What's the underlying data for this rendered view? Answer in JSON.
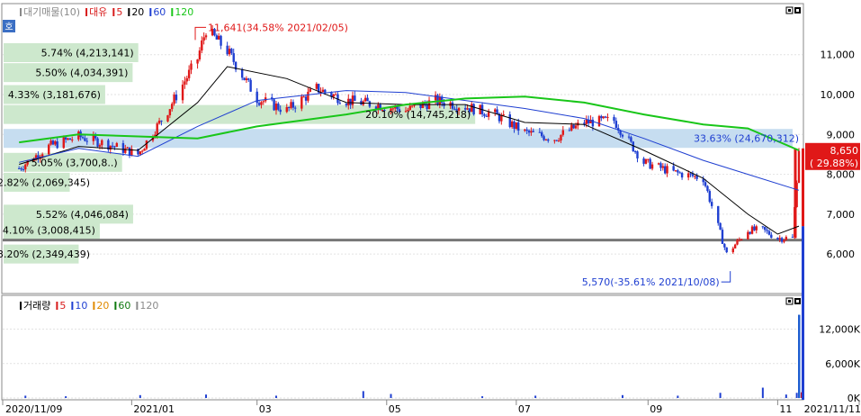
{
  "header": {
    "badge": "호",
    "legend_items": [
      {
        "text": "대기매물(10)",
        "color": "#8a8a8a"
      },
      {
        "text": "대유",
        "color": "#d81b1b"
      },
      {
        "text": "5",
        "color": "#d81b1b"
      },
      {
        "text": "20",
        "color": "#000000"
      },
      {
        "text": "60",
        "color": "#1f3fd1"
      },
      {
        "text": "120",
        "color": "#19c619"
      }
    ]
  },
  "volume_header": {
    "legend_items": [
      {
        "text": "거래량",
        "color": "#000000"
      },
      {
        "text": "5",
        "color": "#d81b1b"
      },
      {
        "text": "10",
        "color": "#1f3fd1"
      },
      {
        "text": "20",
        "color": "#e08a00"
      },
      {
        "text": "60",
        "color": "#0f7a0f"
      },
      {
        "text": "120",
        "color": "#8a8a8a"
      }
    ]
  },
  "chart_data": {
    "type": "candlestick",
    "price_axis": {
      "min": 5000,
      "max": 12000,
      "ticks": [
        "11,000",
        "10,000",
        "9,000",
        "8,000",
        "7,000",
        "6,000"
      ],
      "tick_values": [
        11000,
        10000,
        9000,
        8000,
        7000,
        6000
      ]
    },
    "volume_axis": {
      "min": 0,
      "max": 16000,
      "ticks": [
        "12,000K",
        "6,000K",
        "0K"
      ],
      "tick_values": [
        12000,
        6000,
        0
      ]
    },
    "x_labels": [
      "2020/11/09",
      "2021/01",
      "03",
      "05",
      "07",
      "09",
      "11",
      "2021/11/11"
    ],
    "x_label_dates": [
      "2020-11-09",
      "2021-01-01",
      "2021-03-01",
      "2021-05-01",
      "2021-07-01",
      "2021-09-01",
      "2021-11-01",
      "2021-11-11"
    ],
    "price_series": {
      "dates": [
        "2020-11-09",
        "2020-11-23",
        "2020-12-07",
        "2020-12-21",
        "2021-01-04",
        "2021-01-18",
        "2021-02-01",
        "2021-02-05",
        "2021-02-15",
        "2021-03-01",
        "2021-03-15",
        "2021-03-29",
        "2021-04-12",
        "2021-04-26",
        "2021-05-10",
        "2021-05-24",
        "2021-06-07",
        "2021-06-21",
        "2021-07-05",
        "2021-07-19",
        "2021-08-02",
        "2021-08-16",
        "2021-08-30",
        "2021-09-13",
        "2021-09-27",
        "2021-10-08",
        "2021-10-18",
        "2021-10-25",
        "2021-11-01",
        "2021-11-08",
        "2021-11-11"
      ],
      "close": [
        8150,
        8700,
        8950,
        8750,
        8500,
        9600,
        10900,
        11641,
        11100,
        9900,
        9600,
        10150,
        9850,
        9750,
        9600,
        9850,
        9700,
        9500,
        9050,
        8900,
        9300,
        9350,
        8300,
        8050,
        7900,
        6000,
        6600,
        6600,
        6400,
        6400,
        8650
      ]
    },
    "ma_lines": [
      {
        "name": "20",
        "color": "#000000",
        "dates": [
          "2020-11-09",
          "2020-12-07",
          "2021-01-04",
          "2021-02-01",
          "2021-02-15",
          "2021-03-15",
          "2021-04-12",
          "2021-05-10",
          "2021-06-07",
          "2021-07-05",
          "2021-08-02",
          "2021-08-30",
          "2021-09-27",
          "2021-10-18",
          "2021-11-01",
          "2021-11-11"
        ],
        "values": [
          8250,
          8700,
          8600,
          9800,
          10700,
          10400,
          9800,
          9750,
          9750,
          9300,
          9250,
          8600,
          7900,
          7000,
          6500,
          6700
        ]
      },
      {
        "name": "60",
        "color": "#1f3fd1",
        "dates": [
          "2020-11-09",
          "2020-12-07",
          "2021-01-04",
          "2021-02-01",
          "2021-03-01",
          "2021-04-12",
          "2021-05-10",
          "2021-06-07",
          "2021-07-05",
          "2021-08-02",
          "2021-08-30",
          "2021-09-27",
          "2021-10-18",
          "2021-11-11"
        ],
        "values": [
          8300,
          8650,
          8450,
          9200,
          9850,
          10100,
          10050,
          9850,
          9650,
          9400,
          8900,
          8350,
          8000,
          7600
        ]
      },
      {
        "name": "120",
        "color": "#19c619",
        "dates": [
          "2020-11-09",
          "2020-12-07",
          "2021-01-04",
          "2021-02-01",
          "2021-03-01",
          "2021-04-12",
          "2021-05-10",
          "2021-06-07",
          "2021-07-05",
          "2021-08-02",
          "2021-08-30",
          "2021-09-27",
          "2021-10-18",
          "2021-11-11"
        ],
        "values": [
          8800,
          9000,
          8950,
          8900,
          9200,
          9500,
          9750,
          9900,
          9950,
          9800,
          9500,
          9250,
          9150,
          8600
        ]
      }
    ],
    "volume_profile": [
      {
        "label": "5.74% (4,213,141)",
        "price": 11050,
        "pct": 5.74
      },
      {
        "label": "5.50% (4,034,391)",
        "price": 10550,
        "pct": 5.5
      },
      {
        "label": "4.33% (3,181,676)",
        "price": 10000,
        "pct": 4.33
      },
      {
        "label": "20.10% (14,745,218)",
        "price": 9500,
        "pct": 20.1
      },
      {
        "label": "33.63% (24,670,312)",
        "price": 8900,
        "pct": 33.63
      },
      {
        "label": "5.05% (3,700,8..)",
        "price": 8300,
        "pct": 5.05
      },
      {
        "label": "2.82% (2,069,345)",
        "price": 7800,
        "pct": 2.82
      },
      {
        "label": "5.52% (4,046,084)",
        "price": 7000,
        "pct": 5.52
      },
      {
        "label": "4.10% (3,008,415)",
        "price": 6600,
        "pct": 4.1
      },
      {
        "label": "3.20% (2,349,439)",
        "price": 6000,
        "pct": 3.2
      }
    ],
    "reference_line": {
      "price": 6350
    },
    "annotations": {
      "high": {
        "text": "11,641(34.58% 2021/02/05)",
        "date": "2021-02-05",
        "price": 11641
      },
      "low": {
        "text": "5,570(-35.61% 2021/10/08)",
        "date": "2021-10-08",
        "price": 5570
      }
    },
    "current_price": {
      "value": "8,650",
      "change": "( 29.88%)",
      "price": 8650
    },
    "volume_series": {
      "dates": [
        "2020-11-12",
        "2020-12-01",
        "2021-01-05",
        "2021-02-05",
        "2021-03-10",
        "2021-04-20",
        "2021-05-03",
        "2021-06-15",
        "2021-07-10",
        "2021-08-20",
        "2021-09-15",
        "2021-10-05",
        "2021-10-25",
        "2021-11-05",
        "2021-11-10",
        "2021-11-11"
      ],
      "values": [
        400,
        300,
        500,
        600,
        400,
        1200,
        700,
        300,
        400,
        500,
        400,
        900,
        1800,
        600,
        900,
        14500
      ]
    }
  }
}
